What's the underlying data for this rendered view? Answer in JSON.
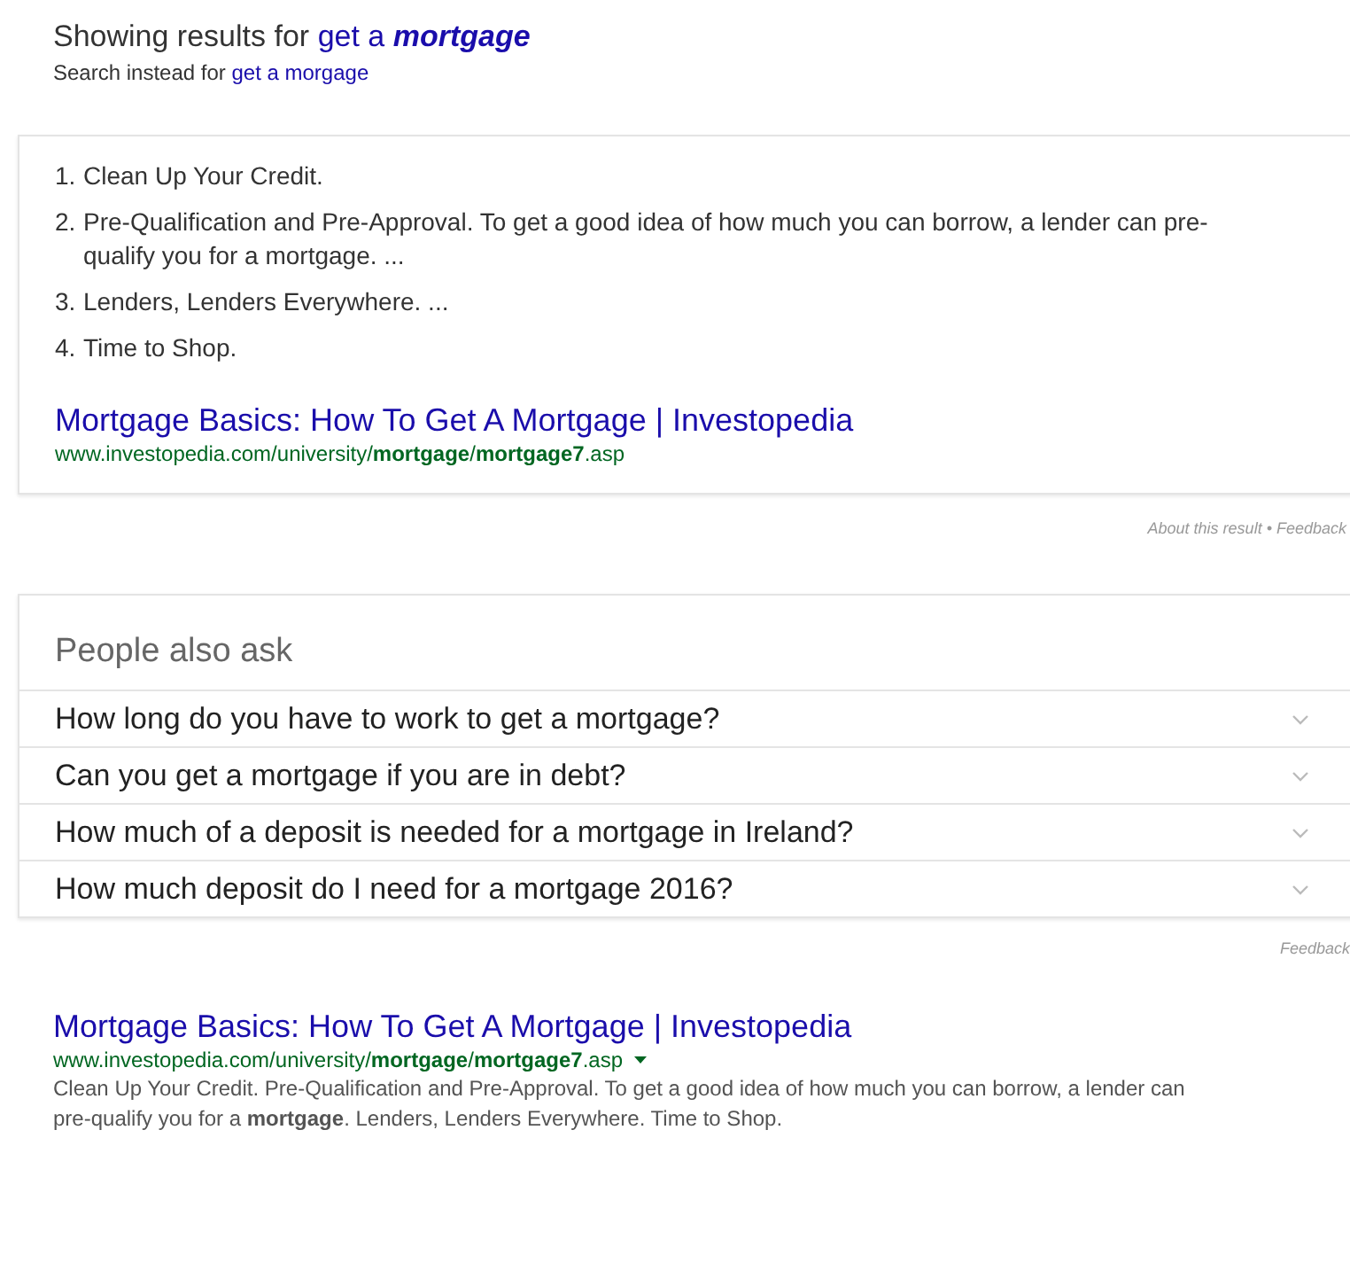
{
  "spelling": {
    "showing_label": "Showing results for",
    "corrected_query": "get a *mortgage*",
    "instead_label": "Search instead for",
    "original_query": "get a morgage"
  },
  "featured_snippet": {
    "steps": [
      {
        "number": "1.",
        "text": "Clean Up Your Credit."
      },
      {
        "number": "2.",
        "text": "Pre-Qualification and Pre-Approval. To get a good idea of how much you can borrow, a lender can pre-qualify you for a mortgage. ..."
      },
      {
        "number": "3.",
        "text": "Lenders, Lenders Everywhere. ..."
      },
      {
        "number": "4.",
        "text": "Time to Shop."
      }
    ],
    "title": "Mortgage Basics: How To Get A Mortgage | Investopedia",
    "url": "www.investopedia.com/university/**mortgage**/**mortgage7**.asp",
    "footer": "About this result • Feedback"
  },
  "people_also_ask": {
    "heading": "People also ask",
    "questions": [
      {
        "text": "How long do you have to work to get a mortgage?",
        "expanded": false
      },
      {
        "text": "Can you get a mortgage if you are in debt?",
        "expanded": false
      },
      {
        "text": "How much of a deposit is needed for a mortgage in Ireland?",
        "expanded": false
      },
      {
        "text": "How much deposit do I need for a mortgage 2016?",
        "expanded": false
      }
    ],
    "footer": "Feedback"
  },
  "result": {
    "title": "Mortgage Basics: How To Get A Mortgage | Investopedia",
    "url": "www.investopedia.com/university/**mortgage**/**mortgage7**.asp",
    "snippet": "Clean Up Your Credit. Pre-Qualification and Pre-Approval. To get a good idea of how much you can borrow, a lender can pre-qualify you for a **mortgage**. Lenders, Lenders Everywhere. Time to Shop."
  }
}
